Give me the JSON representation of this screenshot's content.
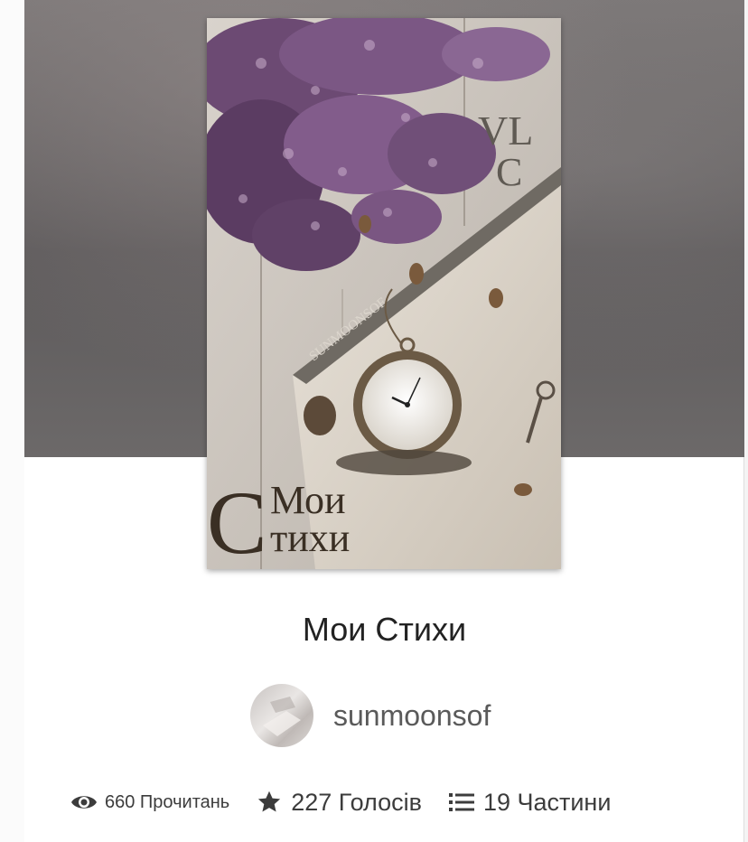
{
  "story": {
    "title": "Мои Стихи",
    "author": "sunmoonsof",
    "cover": {
      "monogram_top": "VL",
      "monogram_bottom": "C",
      "spine_text": "SUNMOONSOF",
      "title_initial": "С",
      "title_line1": "Мои",
      "title_line2": "тихи"
    }
  },
  "stats": {
    "reads_label": "660 Прочитань",
    "votes_label": "227 Голосів",
    "parts_label": "19 Частини"
  },
  "icons": {
    "reads": "eye-icon",
    "votes": "star-icon",
    "parts": "list-icon"
  }
}
